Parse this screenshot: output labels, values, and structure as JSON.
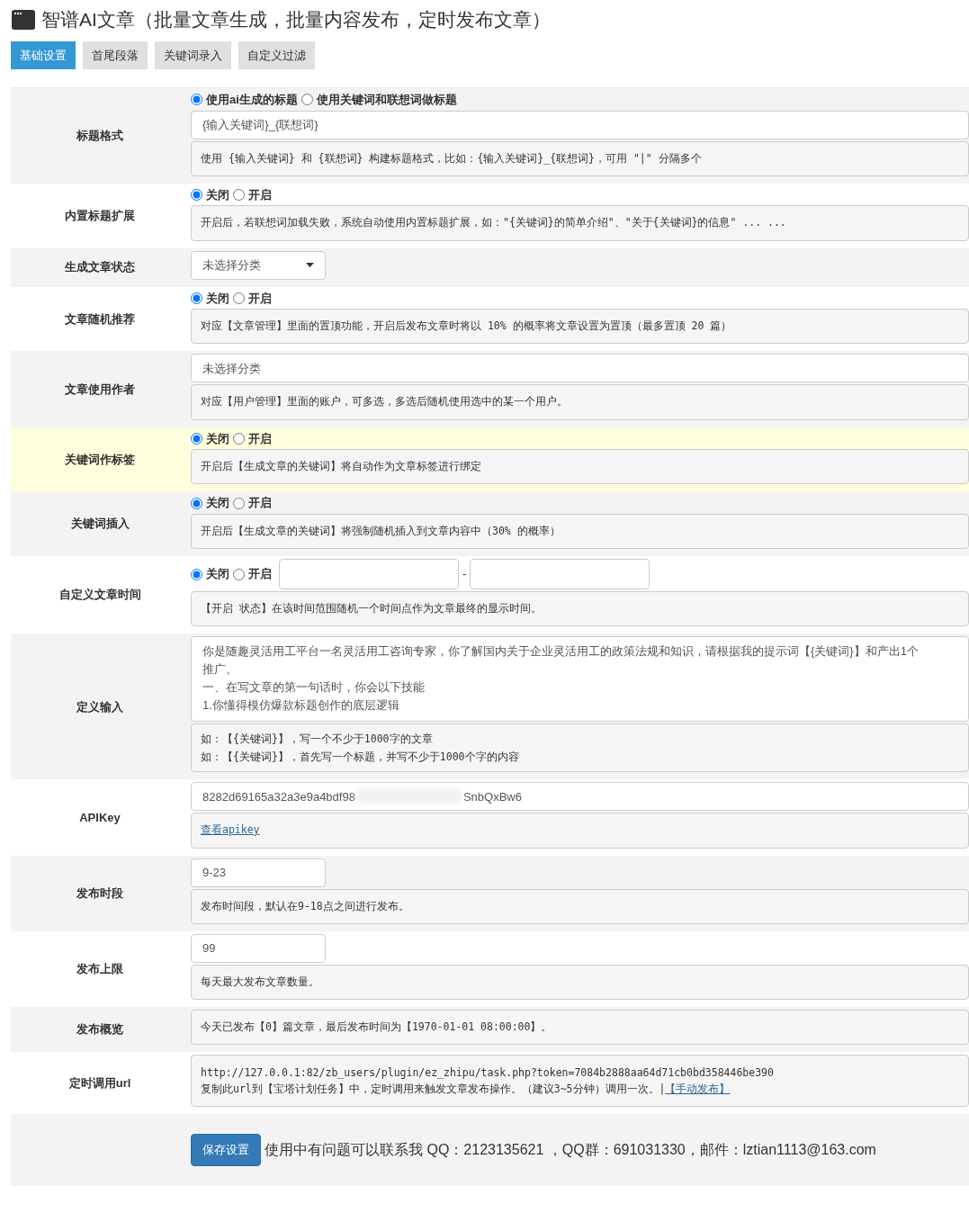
{
  "page_title": "智谱AI文章（批量文章生成，批量内容发布，定时发布文章）",
  "tabs": [
    {
      "label": "基础设置",
      "selected": true
    },
    {
      "label": "首尾段落",
      "selected": false
    },
    {
      "label": "关键词录入",
      "selected": false
    },
    {
      "label": "自定义过滤",
      "selected": false
    }
  ],
  "rows": [
    {
      "label": "标题格式",
      "highlight": false,
      "controls": [
        {
          "kind": "radios",
          "options": [
            {
              "label": "使用ai生成的标题",
              "selected": true
            },
            {
              "label": "使用关键词和联想词做标题",
              "selected": false
            }
          ]
        },
        {
          "kind": "input",
          "value": "{输入关键词}_{联想词}"
        },
        {
          "kind": "hint",
          "text": "使用 {输入关键词} 和 {联想词} 构建标题格式，比如：{输入关键词}_{联想词}，可用 \"|\" 分隔多个"
        }
      ]
    },
    {
      "label": "内置标题扩展",
      "highlight": false,
      "controls": [
        {
          "kind": "radios",
          "options": [
            {
              "label": "关闭",
              "selected": true
            },
            {
              "label": "开启",
              "selected": false
            }
          ]
        },
        {
          "kind": "hint",
          "text": "开启后，若联想词加载失败，系统自动使用内置标题扩展，如：\"{关键词}的简单介绍\"、\"关于{关键词}的信息\" ... ..."
        }
      ]
    },
    {
      "label": "生成文章状态",
      "highlight": false,
      "controls": [
        {
          "kind": "select",
          "value": "未选择分类"
        }
      ]
    },
    {
      "label": "文章随机推荐",
      "highlight": false,
      "controls": [
        {
          "kind": "radios",
          "options": [
            {
              "label": "关闭",
              "selected": true
            },
            {
              "label": "开启",
              "selected": false
            }
          ]
        },
        {
          "kind": "hint",
          "text": "对应【文章管理】里面的置顶功能，开启后发布文章时将以 10% 的概率将文章设置为置顶（最多置顶 20 篇）"
        }
      ]
    },
    {
      "label": "文章使用作者",
      "highlight": false,
      "controls": [
        {
          "kind": "input",
          "value": "未选择分类"
        },
        {
          "kind": "hint",
          "text": "对应【用户管理】里面的账户，可多选，多选后随机使用选中的某一个用户。"
        }
      ]
    },
    {
      "label": "关键词作标签",
      "highlight": true,
      "controls": [
        {
          "kind": "radios",
          "options": [
            {
              "label": "关闭",
              "selected": true
            },
            {
              "label": "开启",
              "selected": false
            }
          ]
        },
        {
          "kind": "hint",
          "text": "开启后【生成文章的关键词】将自动作为文章标签进行绑定"
        }
      ]
    },
    {
      "label": "关键词插入",
      "highlight": false,
      "controls": [
        {
          "kind": "radios",
          "options": [
            {
              "label": "关闭",
              "selected": true
            },
            {
              "label": "开启",
              "selected": false
            }
          ]
        },
        {
          "kind": "hint",
          "text": "开启后【生成文章的关键词】将强制随机插入到文章内容中（30% 的概率）"
        }
      ]
    },
    {
      "label": "自定义文章时间",
      "highlight": false,
      "controls": [
        {
          "kind": "radios",
          "options": [
            {
              "label": "关闭",
              "selected": true
            },
            {
              "label": "开启",
              "selected": false
            }
          ],
          "range_separator": "-"
        },
        {
          "kind": "hint",
          "text": "【开启 状态】在该时间范围随机一个时间点作为文章最终的显示时间。"
        }
      ]
    },
    {
      "label": "定义输入",
      "highlight": false,
      "controls": [
        {
          "kind": "textarea",
          "lines": [
            "你是随趣灵活用工平台一名灵活用工咨询专家，你了解国内关于企业灵活用工的政策法规和知识，请根据我的提示词【{关键词}】和产出1个",
            "推广。",
            "一、在写文章的第一句话时，你会以下技能",
            "1.你懂得模仿爆款标题创作的底层逻辑"
          ]
        },
        {
          "kind": "hint_lines",
          "lines": [
            "如：【{关键词}】，写一个不少于1000字的文章",
            "如：【{关键词}】，首先写一个标题，并写不少于1000个字的内容"
          ]
        }
      ]
    },
    {
      "label": "APIKey",
      "highlight": false,
      "controls": [
        {
          "kind": "masked_input",
          "prefix": "8282d69165a32a3e9a4bdf98",
          "suffix": "SnbQxBw6"
        },
        {
          "kind": "link_hint",
          "text": "查看apikey"
        }
      ]
    },
    {
      "label": "发布时段",
      "highlight": false,
      "controls": [
        {
          "kind": "short_input",
          "value": "9-23"
        },
        {
          "kind": "hint",
          "text": "发布时间段，默认在9-18点之间进行发布。"
        }
      ]
    },
    {
      "label": "发布上限",
      "highlight": false,
      "controls": [
        {
          "kind": "short_input",
          "value": "99"
        },
        {
          "kind": "hint",
          "text": "每天最大发布文章数量。"
        }
      ]
    },
    {
      "label": "发布概览",
      "highlight": false,
      "controls": [
        {
          "kind": "hint",
          "text": "今天已发布【0】篇文章，最后发布时间为【1970-01-01 08:00:00】。"
        }
      ]
    },
    {
      "label": "定时调用url",
      "highlight": false,
      "controls": [
        {
          "kind": "url_hint",
          "url": "http://127.0.0.1:82/zb_users/plugin/ez_zhipu/task.php?token=7084b2888aa64d71cb0bd358446be390",
          "text": "复制此url到【宝塔计划任务】中，定时调用来触发文章发布操作。（建议3~5分钟）调用一次。|",
          "link": "【手动发布】"
        }
      ]
    },
    {
      "label": "",
      "highlight": false,
      "controls": [
        {
          "kind": "save",
          "button": "保存设置",
          "note": "使用中有问题可以联系我 QQ：2123135621 ，QQ群：691031330，邮件：lztian1113@163.com"
        }
      ]
    }
  ]
}
